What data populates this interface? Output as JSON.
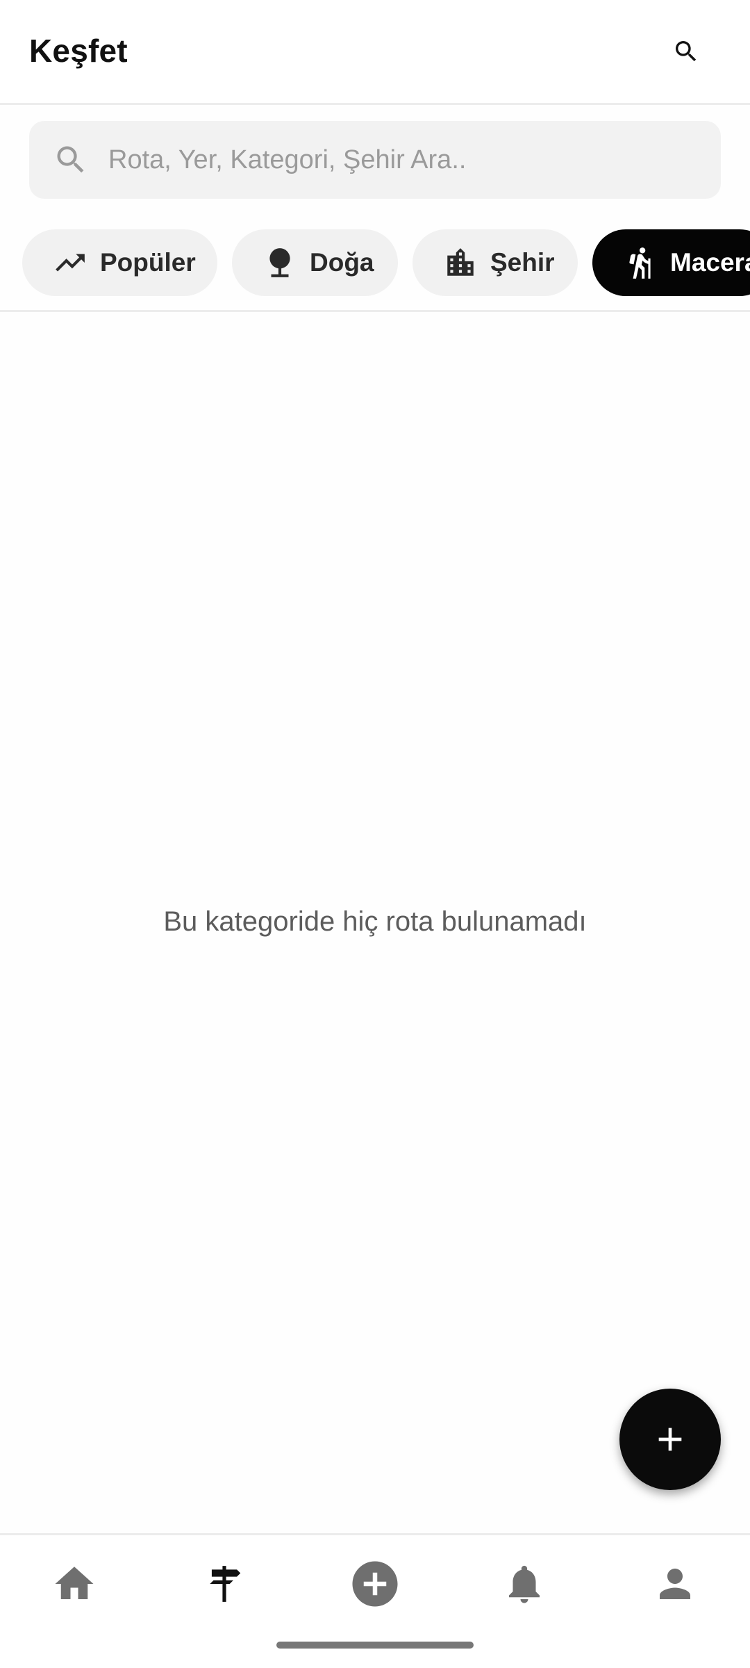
{
  "appbar": {
    "title": "Keşfet",
    "search_icon": "search-icon"
  },
  "search": {
    "placeholder": "Rota, Yer, Kategori, Şehir Ara..",
    "value": "",
    "icon": "search-icon"
  },
  "chips": [
    {
      "label": "Popüler",
      "icon": "trending-up-icon",
      "active": false
    },
    {
      "label": "Doğa",
      "icon": "tree-icon",
      "active": false
    },
    {
      "label": "Şehir",
      "icon": "city-icon",
      "active": false
    },
    {
      "label": "Macera",
      "icon": "hiking-icon",
      "active": true
    }
  ],
  "empty_state": {
    "message": "Bu kategoride hiç rota bulunamadı"
  },
  "fab": {
    "icon": "plus-icon"
  },
  "bottom_nav": {
    "items": [
      {
        "icon": "home-icon",
        "active": false
      },
      {
        "icon": "signpost-icon",
        "active": true
      },
      {
        "icon": "add-circle-icon",
        "active": false
      },
      {
        "icon": "bell-icon",
        "active": false
      },
      {
        "icon": "person-icon",
        "active": false
      }
    ]
  },
  "colors": {
    "active_chip_bg": "#050505",
    "chip_bg": "#f1f1f1",
    "inactive_nav_icon": "#6f6f6f",
    "active_nav_icon": "#111111",
    "fab_bg": "#0b0b0b"
  }
}
